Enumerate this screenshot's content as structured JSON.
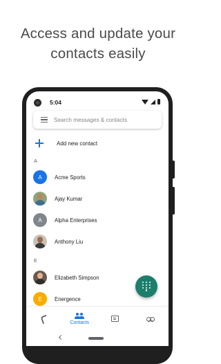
{
  "headline": {
    "line1": "Access and update your",
    "line2": "contacts easily"
  },
  "status_bar": {
    "time": "5:04"
  },
  "search": {
    "placeholder": "Search messages & contacts"
  },
  "add_contact": {
    "label": "Add new contact"
  },
  "sections": [
    {
      "letter": "A",
      "contacts": [
        {
          "name": "Acme Sports",
          "initial": "A",
          "color": "#1a73e8"
        },
        {
          "name": "Ajay Kumar",
          "initial": "",
          "photo": true
        },
        {
          "name": "Alpha Enterprises",
          "initial": "A",
          "color": "#80868b"
        },
        {
          "name": "Anthony Liu",
          "initial": "",
          "photo": true
        }
      ]
    },
    {
      "letter": "E",
      "contacts": [
        {
          "name": "Elizabeth Simpson",
          "initial": "",
          "photo": true
        },
        {
          "name": "Energence",
          "initial": "E",
          "color": "#f9ab00"
        }
      ]
    }
  ],
  "bottom_nav": {
    "contacts_label": "Contacts"
  },
  "colors": {
    "accent": "#1a73e8",
    "fab": "#1b7f6c"
  }
}
